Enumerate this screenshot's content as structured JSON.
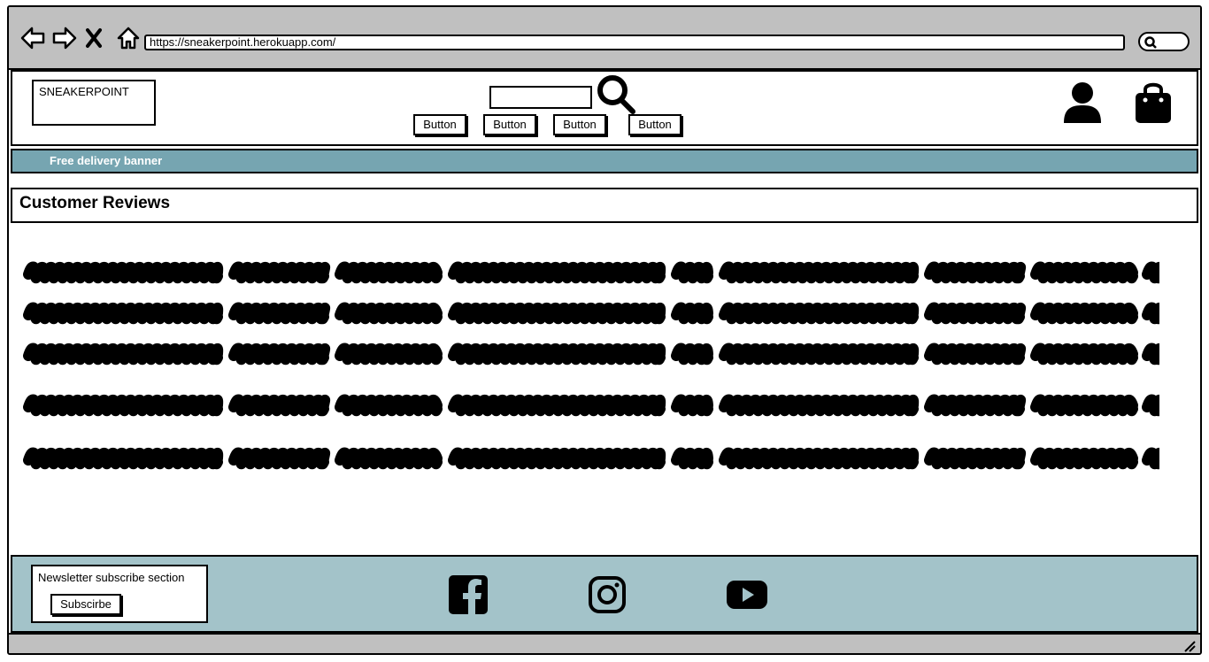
{
  "browser": {
    "url": "https://sneakerpoint.herokuapp.com/",
    "nav_icons": [
      "back-arrow-icon",
      "forward-arrow-icon",
      "close-icon",
      "home-icon"
    ],
    "search_icon": "search-icon"
  },
  "header": {
    "logo_text": "SNEAKERPOINT",
    "search_placeholder": "",
    "nav_buttons": [
      "Button",
      "Button",
      "Button",
      "Button"
    ],
    "icons": [
      "search-icon",
      "user-icon",
      "shopping-bag-icon"
    ]
  },
  "banner": {
    "text": "Free delivery banner",
    "color": "#76a5b1"
  },
  "reviews": {
    "title": "Customer Reviews",
    "lines": 5
  },
  "footer": {
    "newsletter_label": "Newsletter subscribe section",
    "subscribe_label": "Subscirbe",
    "social_icons": [
      "facebook-icon",
      "instagram-icon",
      "youtube-icon"
    ],
    "color": "#a3c3c9"
  },
  "colors": {
    "chrome": "#c0c0c0",
    "banner": "#76a5b1",
    "footer": "#a3c3c9"
  }
}
